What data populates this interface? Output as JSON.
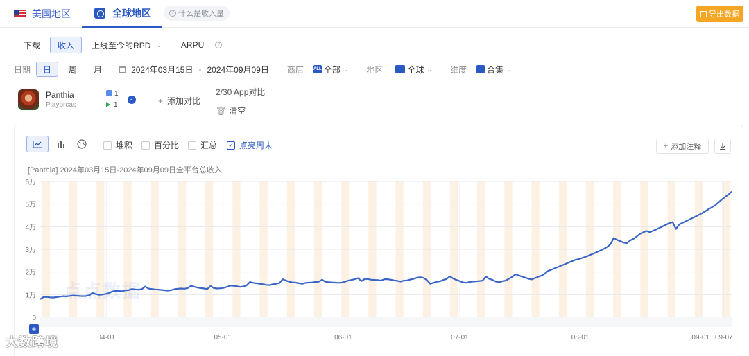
{
  "tabs": {
    "us": "美国地区",
    "global": "全球地区",
    "help": "什么是收入量",
    "export": "导出数据"
  },
  "metrics": [
    "下载",
    "收入",
    "上线至今的RPD",
    "ARPU"
  ],
  "active_metric": "收入",
  "filters": {
    "date_label": "日期",
    "granularity": [
      "日",
      "周",
      "月"
    ],
    "active_granularity": "日",
    "start_date": "2024年03月15日",
    "end_date": "2024年09月09日",
    "date_separator": "-",
    "store_label": "商店",
    "store_value": "全部",
    "store_badge": "ALL",
    "region_label": "地区",
    "region_value": "全球",
    "dimension_label": "维度",
    "dimension_value": "合集"
  },
  "app": {
    "name": "Panthia",
    "developer": "Playorcas",
    "ios_rank": "1",
    "gp_rank": "1",
    "add_compare": "添加对比",
    "compare_count": "2/30 App对比",
    "clear": "清空"
  },
  "chart_options": {
    "stack": "堆积",
    "percent": "百分比",
    "summary": "汇总",
    "highlight_weekend": "点亮周末",
    "add_note": "添加注释"
  },
  "colors": {
    "line": "#3a65c8",
    "weekend_band": "#fdf1e3",
    "accent": "#2b59c3",
    "export": "#f5a623"
  },
  "watermark": "点点数据",
  "footer_watermark": "大数跨境",
  "chart_data": {
    "type": "line",
    "title": "[Panthia]  2024年03月15日-2024年09月09日全平台总收入",
    "x_start": "2024-03-15",
    "x_end": "2024-09-09",
    "x_tick_labels": [
      "04-01",
      "05-01",
      "06-01",
      "07-01",
      "08-01",
      "09-01",
      "09-07"
    ],
    "x_tick_dates": [
      "2024-04-01",
      "2024-05-01",
      "2024-06-01",
      "2024-07-01",
      "2024-08-01",
      "2024-09-01",
      "2024-09-07"
    ],
    "y_tick_labels": [
      "0",
      "1万",
      "2万",
      "3万",
      "4万",
      "5万",
      "6万"
    ],
    "ylim": [
      0,
      60000
    ],
    "weekend_highlight": true,
    "grid": true,
    "series": [
      {
        "values": [
          8000,
          8900,
          9000,
          8800,
          8700,
          8900,
          9100,
          9300,
          9200,
          9400,
          9600,
          9500,
          9400,
          9300,
          9400,
          9700,
          10800,
          10200,
          9900,
          10000,
          10300,
          10700,
          11400,
          11700,
          11600,
          11500,
          11900,
          12000,
          12500,
          12300,
          12200,
          12400,
          13600,
          12700,
          12500,
          12300,
          12200,
          12100,
          11900,
          11800,
          12000,
          12400,
          12600,
          12700,
          12600,
          12900,
          13900,
          13500,
          13100,
          12900,
          12700,
          12500,
          13800,
          12900,
          12700,
          12800,
          13000,
          13400,
          14000,
          13900,
          13700,
          13400,
          13600,
          14100,
          15600,
          15200,
          15000,
          14800,
          14600,
          14300,
          14200,
          14600,
          14800,
          15100,
          16800,
          16200,
          15700,
          15400,
          15300,
          15000,
          14800,
          15200,
          15300,
          15400,
          15600,
          15700,
          16600,
          15700,
          15500,
          15400,
          15300,
          15200,
          15300,
          15700,
          16200,
          16500,
          16800,
          17300,
          16000,
          16900,
          16900,
          16600,
          16500,
          16400,
          16200,
          16800,
          16800,
          16600,
          16300,
          16100,
          15800,
          16200,
          16300,
          16700,
          17000,
          17500,
          17700,
          17400,
          16400,
          14800,
          15200,
          15700,
          15900,
          16500,
          16900,
          18100,
          17100,
          16500,
          16000,
          15400,
          15200,
          15600,
          15800,
          15900,
          16000,
          16200,
          18000,
          17000,
          16500,
          15800,
          15500,
          15900,
          16200,
          17000,
          17800,
          19000,
          18500,
          18000,
          17500,
          17000,
          16700,
          17300,
          17900,
          18400,
          19300,
          20500,
          21000,
          21600,
          22200,
          22800,
          23400,
          24000,
          24600,
          25200,
          25600,
          26000,
          26500,
          27000,
          27600,
          28200,
          28900,
          29500,
          30200,
          31000,
          32200,
          35000,
          34200,
          33600,
          33000,
          32700,
          33900,
          34600,
          35600,
          36800,
          37500,
          38100,
          37600,
          38200,
          38800,
          39500,
          40200,
          40900,
          41600,
          42000,
          39000,
          41000,
          41700,
          42400,
          43100,
          43800,
          44500,
          45200,
          46000,
          46900,
          47800,
          48600,
          49500,
          50800,
          52000,
          53100,
          54200,
          55500
        ]
      }
    ]
  }
}
